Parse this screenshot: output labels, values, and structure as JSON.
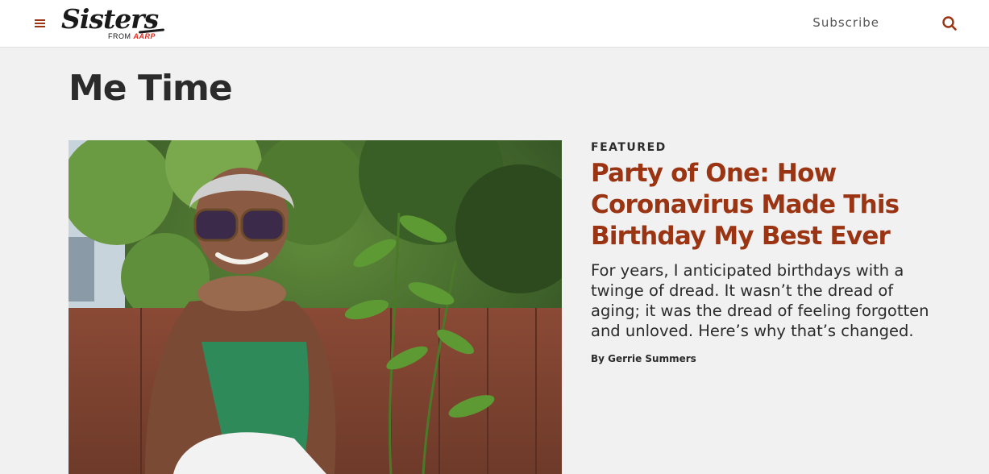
{
  "header": {
    "logo": {
      "wordmark": "Sisters",
      "from_text": "FROM",
      "brand": "AARP"
    },
    "menu_icon": "hamburger-menu-icon",
    "subscribe_label": "Subscribe",
    "search_icon": "search-icon",
    "accent_color": "#9a3412"
  },
  "main": {
    "section_title": "Me Time",
    "featured": {
      "eyebrow": "FEATURED",
      "headline": "Party of One: How Coronavirus Made This Birthday My Best Ever",
      "summary": "For years, I anticipated birthdays with a twinge of dread. It wasn’t the dread of aging; it was the dread of feeling forgotten and unloved. Here’s why that’s changed.",
      "byline": "By Gerrie Summers",
      "headline_color": "#9a3412"
    }
  }
}
